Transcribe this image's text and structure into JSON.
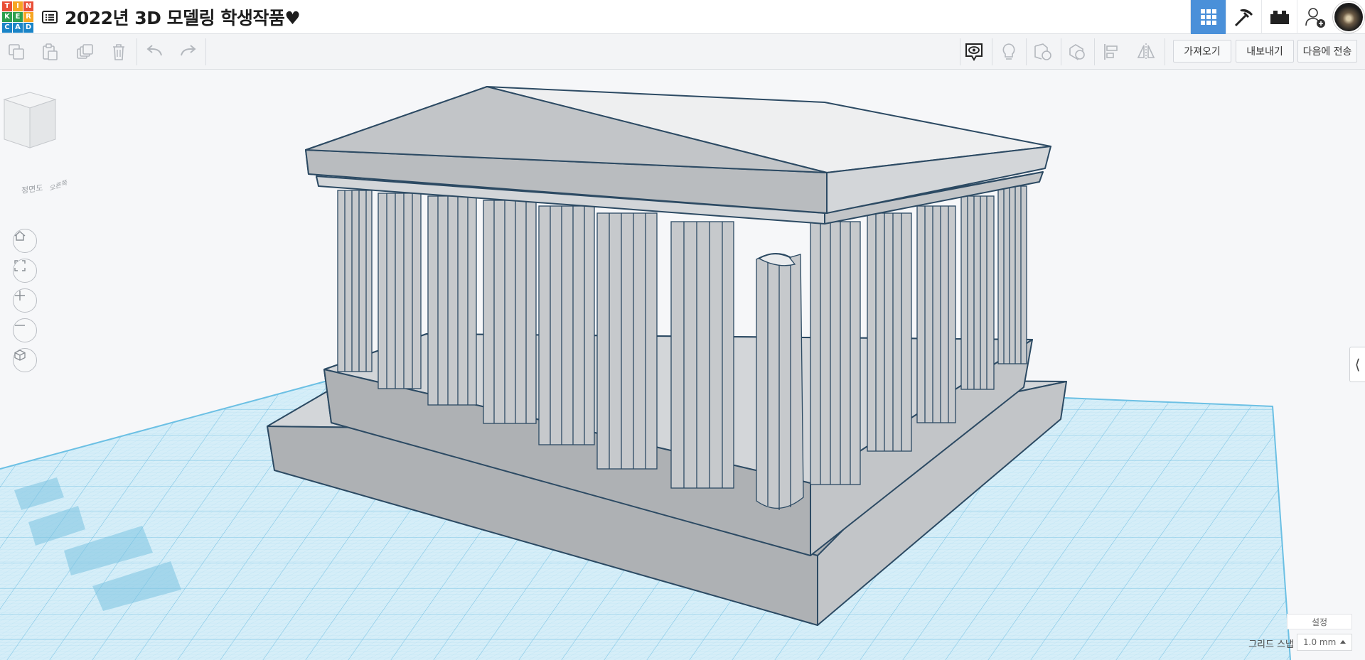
{
  "header": {
    "logo_letters": [
      "T",
      "I",
      "N",
      "K",
      "E",
      "R",
      "C",
      "A",
      "D"
    ],
    "logo_colors": [
      "#e94f37",
      "#f6a623",
      "#e94f37",
      "#2d9f4e",
      "#2d9f4e",
      "#f6a623",
      "#1a84c7",
      "#1a84c7",
      "#1a84c7"
    ],
    "title": "2022년 3D 모델링 학생작품♥",
    "buttons": [
      {
        "name": "3d-design-view",
        "icon": "grid-icon",
        "active": true
      },
      {
        "name": "build-blocks-view",
        "icon": "pickaxe-icon",
        "active": false
      },
      {
        "name": "bricks-view",
        "icon": "brick-icon",
        "active": false
      },
      {
        "name": "invite-user",
        "icon": "add-user-icon",
        "active": false
      }
    ],
    "accent_color": "#4a90d9"
  },
  "toolbar": {
    "edit_icons": [
      "copy-icon",
      "paste-icon",
      "duplicate-icon",
      "delete-icon",
      "undo-icon",
      "redo-icon"
    ],
    "right_icons": [
      "notes-visibility-icon",
      "lightbulb-icon",
      "workplane-icon",
      "ruler-icon",
      "align-icon",
      "mirror-icon"
    ],
    "import_label": "가져오기",
    "export_label": "내보내기",
    "send_to_label": "다음에 전송"
  },
  "view_cube": {
    "front_label": "정면도",
    "right_label": "오른쪽"
  },
  "view_controls": [
    "home-icon",
    "fit-all-icon",
    "zoom-in-icon",
    "zoom-out-icon",
    "perspective-icon"
  ],
  "workplane": {
    "grid_color": "#7fc7e6",
    "shape_fill": "#d3d6d9",
    "shape_stroke": "#2c4a63"
  },
  "bottom_controls": {
    "settings_label": "설정",
    "grid_snap_label": "그리드 스냅",
    "grid_snap_value": "1.0 mm"
  }
}
